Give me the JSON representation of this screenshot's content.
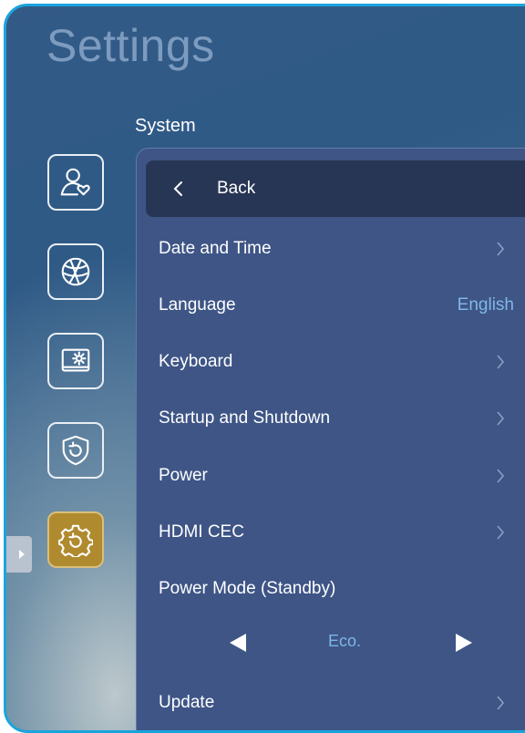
{
  "header": {
    "title": "Settings",
    "section": "System"
  },
  "sidebar": {
    "items": [
      {
        "icon": "user-heart-icon"
      },
      {
        "icon": "globe-network-icon"
      },
      {
        "icon": "display-settings-icon"
      },
      {
        "icon": "shield-refresh-icon"
      },
      {
        "icon": "gear-refresh-icon",
        "active": true
      }
    ]
  },
  "panel": {
    "back_label": "Back",
    "rows": [
      {
        "label": "Date and Time"
      },
      {
        "label": "Language",
        "value": "English"
      },
      {
        "label": "Keyboard"
      },
      {
        "label": "Startup and Shutdown"
      },
      {
        "label": "Power"
      },
      {
        "label": "HDMI CEC"
      },
      {
        "label": "Power Mode (Standby)"
      },
      {
        "label": "Update"
      }
    ],
    "power_mode_value": "Eco."
  },
  "colors": {
    "accent_value": "#7fb7e6",
    "active_item": "#b08a2e",
    "frame": "#1aa4dd"
  }
}
